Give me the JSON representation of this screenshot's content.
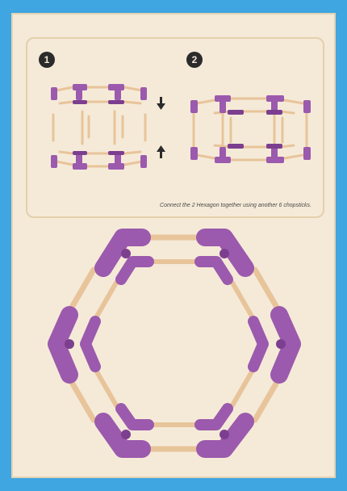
{
  "steps": {
    "step1_number": "1",
    "step2_number": "2"
  },
  "caption": "Connect the 2 Hexagon together using another 6 chopsticks.",
  "colors": {
    "background": "#3fa6e2",
    "paper": "#f5ead8",
    "connector": "#9b5aad",
    "connector_dark": "#7c3f8f",
    "chopstick": "#e8c49a"
  },
  "icons": {
    "arrow_down": "down-arrow-icon",
    "arrow_up": "up-arrow-icon"
  }
}
